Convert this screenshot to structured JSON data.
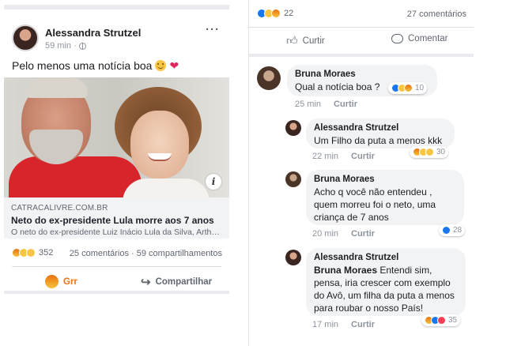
{
  "post": {
    "author": "Alessandra Strutzel",
    "time": "59 min ·",
    "more_icon": "ellipsis-icon",
    "privacy_icon": "globe-icon",
    "text": "Pelo menos uma notícia boa",
    "text_emojis": [
      "slightly-smiling-face",
      "red-heart"
    ],
    "link": {
      "domain": "CATRACALIVRE.COM.BR",
      "title": "Neto do ex-presidente Lula morre aos 7 anos",
      "description": "O neto do ex-presidente Luiz Inácio Lula da Silva, Arthur..."
    },
    "reactions": [
      "angry",
      "sad",
      "wow"
    ],
    "reaction_count": "352",
    "stats": "25 comentários · 59 compartilhamentos",
    "actions": {
      "grr": "Grr",
      "share": "Compartilhar"
    }
  },
  "comments_panel": {
    "reactions": [
      "like",
      "sad",
      "angry"
    ],
    "reaction_count": "22",
    "comments_count": "27 comentários",
    "actions": {
      "like": "Curtir",
      "comment": "Comentar"
    },
    "comments": [
      {
        "author": "Bruna Moraes",
        "text": "Qual a notícia boa ?",
        "time": "25 min",
        "reply_label": "Curtir",
        "reactions": [
          "like",
          "sad",
          "angry"
        ],
        "reaction_count": "10"
      },
      {
        "author": "Alessandra Strutzel",
        "text": "Um Filho da puta a menos kkk",
        "time": "22 min",
        "reply_label": "Curtir",
        "reactions": [
          "angry",
          "sad",
          "haha"
        ],
        "reaction_count": "30"
      },
      {
        "author": "Bruna Moraes",
        "text": "Acho q você não entendeu , quem morreu foi o neto, uma criança de 7 anos",
        "time": "20 min",
        "reply_label": "Curtir",
        "reactions": [
          "like"
        ],
        "reaction_count": "28"
      },
      {
        "author": "Alessandra Strutzel",
        "mention": "Bruna Moraes",
        "text": " Entendi sim, pensa, iria crescer com exemplo do Avô, um filha da puta a menos para roubar o nosso País!",
        "time": "17 min",
        "reply_label": "Curtir",
        "reactions": [
          "angry",
          "like",
          "love"
        ],
        "reaction_count": "35"
      }
    ]
  },
  "colors": {
    "facebook_blue": "#1877f2",
    "grr_orange": "#e9710f",
    "love_red": "#f33e58",
    "bubble_gray": "#f2f3f5",
    "meta_gray": "#8d949e"
  }
}
